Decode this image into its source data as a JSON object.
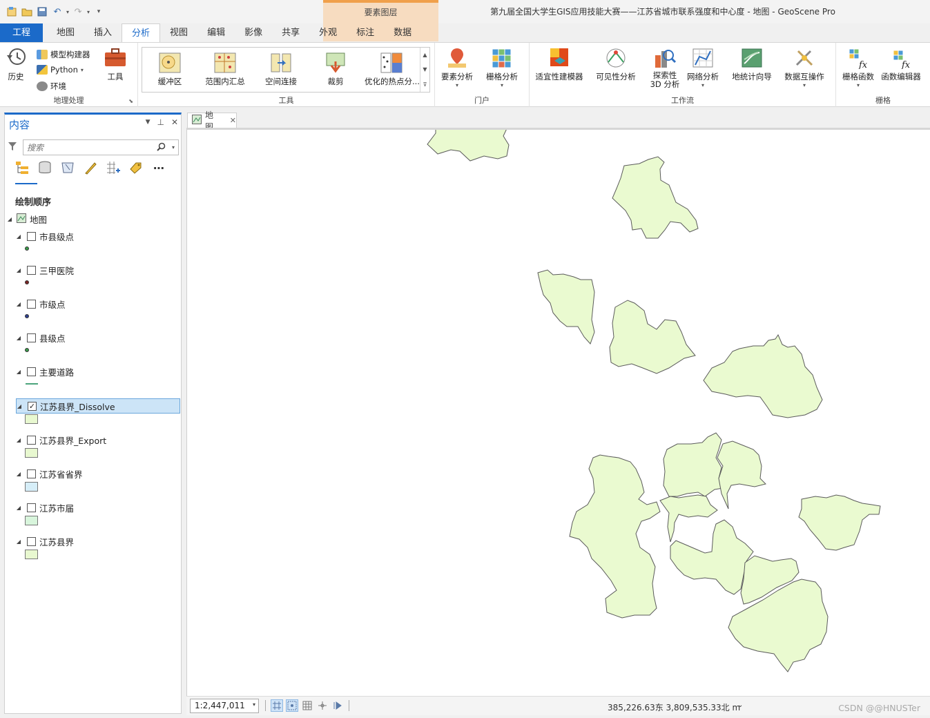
{
  "window": {
    "title": "第九届全国大学生GIS应用技能大赛——江苏省城市联系强度和中心度 - 地图 - GeoScene Pro",
    "contextual_tab_group": "要素图层"
  },
  "tabs": [
    {
      "label": "工程",
      "kind": "project"
    },
    {
      "label": "地图"
    },
    {
      "label": "插入"
    },
    {
      "label": "分析",
      "active": true
    },
    {
      "label": "视图"
    },
    {
      "label": "编辑"
    },
    {
      "label": "影像"
    },
    {
      "label": "共享"
    },
    {
      "label": "外观"
    },
    {
      "label": "标注"
    },
    {
      "label": "数据"
    }
  ],
  "ribbon": {
    "geoprocessing": {
      "label": "地理处理",
      "history": "历史",
      "model_builder": "模型构建器",
      "python": "Python",
      "environments": "环境",
      "tools": "工具"
    },
    "tools_group": {
      "label": "工具",
      "items": [
        "缓冲区",
        "范围内汇总",
        "空间连接",
        "裁剪",
        "优化的热点分..."
      ]
    },
    "portal": {
      "label": "门户",
      "items": [
        "要素分析",
        "栅格分析"
      ]
    },
    "workflows": {
      "label": "工作流",
      "items": [
        "适宜性建模器",
        "可见性分析",
        "探索性",
        "3D 分析",
        "网络分析",
        "地统计向导",
        "数据互操作"
      ]
    },
    "raster": {
      "label": "栅格",
      "items": [
        "栅格函数",
        "函数编辑器"
      ]
    }
  },
  "contents": {
    "title": "内容",
    "search_placeholder": "搜索",
    "draw_order_title": "绘制顺序",
    "map_name": "地图",
    "layers": [
      {
        "name": "市县级点",
        "checked": false,
        "symbol": "point",
        "color": "#3a9a4a"
      },
      {
        "name": "三甲医院",
        "checked": false,
        "symbol": "point",
        "color": "#7a2323"
      },
      {
        "name": "市级点",
        "checked": false,
        "symbol": "point",
        "color": "#2e3f8e"
      },
      {
        "name": "县级点",
        "checked": false,
        "symbol": "point",
        "color": "#3a9a4a"
      },
      {
        "name": "主要道路",
        "checked": false,
        "symbol": "line",
        "color": "#4aa37b"
      },
      {
        "name": "江苏县界_Dissolve",
        "checked": true,
        "selected": true,
        "symbol": "polygon",
        "color": "#e8f8d0"
      },
      {
        "name": "江苏县界_Export",
        "checked": false,
        "symbol": "polygon",
        "color": "#e8f8d0"
      },
      {
        "name": "江苏省省界",
        "checked": false,
        "symbol": "polygon",
        "color": "#d6eef8"
      },
      {
        "name": "江苏市届",
        "checked": false,
        "symbol": "polygon",
        "color": "#d8f5dc"
      },
      {
        "name": "江苏县界",
        "checked": false,
        "symbol": "polygon",
        "color": "#e8f8d0"
      }
    ]
  },
  "map_view": {
    "tab_label": "地图",
    "feature_fill": "#eafad0",
    "feature_stroke": "#5a5a5a"
  },
  "status": {
    "scale": "1:2,447,011",
    "coordinates": "385,226.63东 3,809,535.33北 m"
  },
  "watermark": "CSDN @@HNUSTer"
}
